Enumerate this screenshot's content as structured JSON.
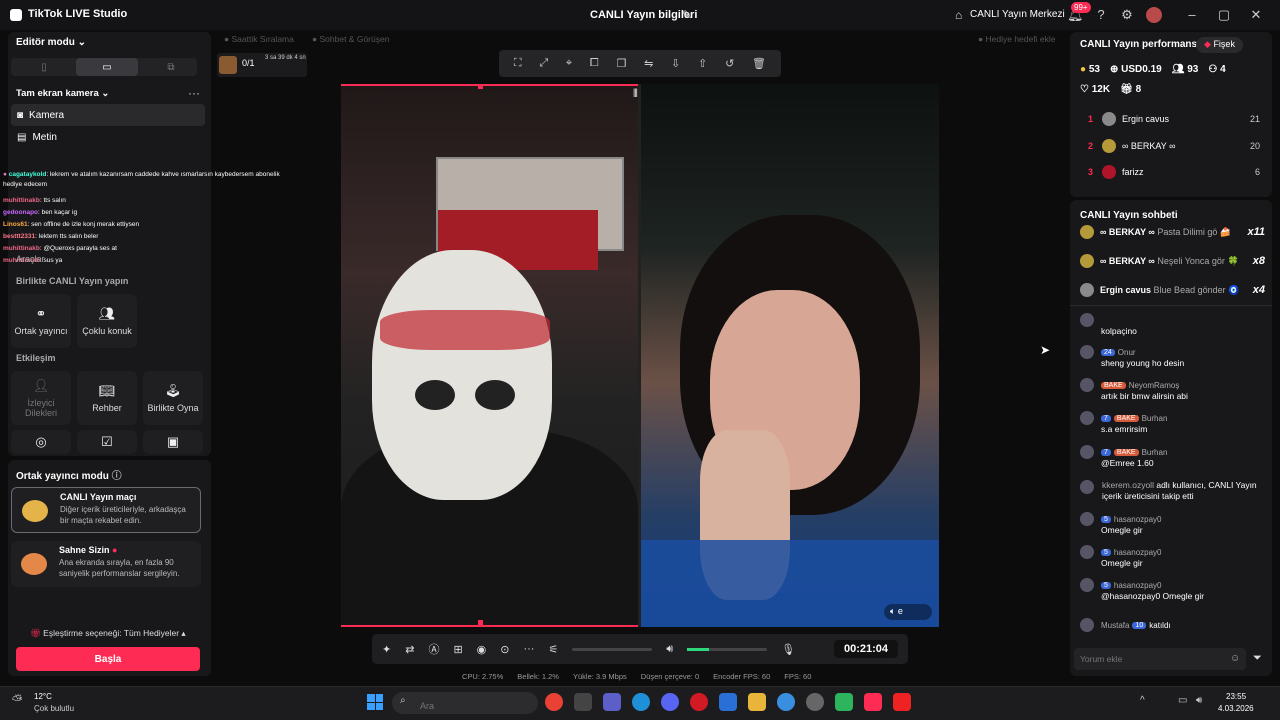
{
  "app": {
    "title": "TikTok LIVE Studio",
    "center_title": "CANLI Yayın bilgileri",
    "home_label": "CANLI Yayın Merkezi",
    "notif_count": "99+"
  },
  "editor": {
    "mode_label": "Editör modu",
    "camera_header": "Tam ekran kamera",
    "sources": [
      "Kamera",
      "Metin"
    ],
    "tools_label": "Araçlar",
    "together_label": "Birlikte CANLI Yayın yapın",
    "together_tiles": [
      "Ortak yayıncı",
      "Çoklu konuk"
    ],
    "interaction_label": "Etkileşim",
    "interaction_tiles": [
      "İzleyici Dilekleri",
      "Rehber",
      "Birlikte Oyna"
    ]
  },
  "cohost": {
    "mode_label": "Ortak yayıncı modu",
    "cards": [
      {
        "title": "CANLI Yayın maçı",
        "desc": "Diğer içerik üreticileriyle, arkadaşça bir maçta rekabet edin."
      },
      {
        "title": "Sahne Sizin",
        "desc": "Ana ekranda sırayla, en fazla 90 saniyelik performanslar sergileyin."
      }
    ],
    "match_option": "Eşleştirme seçeneği: Tüm Hediyeler",
    "start_button": "Başla"
  },
  "overlay_chat": [
    {
      "user": "cagataykold",
      "text": ": lekrem ve atalım kazanırsam caddede kahve ısmarlarsın kaybedersem abonelik hediye edecem"
    },
    {
      "user": "muhittinakb",
      "text": ": tts salın"
    },
    {
      "user": "gedoonapo",
      "text": ": ben kaçar ig"
    },
    {
      "user": "Linos61",
      "text": ": sen offline de izle konj merak ettiysen"
    },
    {
      "user": "besttt2331",
      "text": ": lektem tts salın beler"
    },
    {
      "user": "muhittinakb",
      "text": ": @Queroxs parayla ses at"
    },
    {
      "user": "muhittinakb",
      "text": ": sus ya"
    }
  ],
  "scene_bar": {
    "tab1": "Saattik Sıralama",
    "tab2": "Sohbet & Görüşen",
    "gift_label": "Hediye hedefi ekle",
    "goal_count": "0/1",
    "goal_time": "3 sa 39 dk 4 sn"
  },
  "controls": {
    "timer": "00:21:04"
  },
  "stats": {
    "cpu": "CPU: 2.75%",
    "mem": "Bellek: 1.2%",
    "upload": "Yükle: 3.9 Mbps",
    "dropped": "Düşen çerçeve: 0",
    "encoder": "Encoder FPS: 60",
    "fps": "FPS: 60"
  },
  "performance": {
    "title": "CANLI Yayın performansı",
    "badge": "Fişek",
    "coins": "53",
    "usd": "USD0.19",
    "viewers": "93",
    "people": "4",
    "likes": "12K",
    "gifts": "8",
    "leaderboard": [
      {
        "rank": "1",
        "name": "Ergin cavus",
        "score": "21",
        "color": "#8a8a8a"
      },
      {
        "rank": "2",
        "name": "∞ BERKAY ∞",
        "score": "20",
        "color": "#b59a3a"
      },
      {
        "rank": "3",
        "name": "farizz",
        "score": "6",
        "color": "#b0142a"
      }
    ]
  },
  "chat": {
    "title": "CANLI Yayın sohbeti",
    "gifts": [
      {
        "name": "∞ BERKAY ∞",
        "action": "Pasta Dilimi gö",
        "count": "x11",
        "icon": "🍰"
      },
      {
        "name": "∞ BERKAY ∞",
        "action": "Neşeli Yonca gör",
        "count": "x8",
        "icon": "🍀"
      },
      {
        "name": "Ergin cavus",
        "action": "Blue Bead gönder",
        "count": "x4",
        "icon": "🧿"
      }
    ],
    "messages": [
      {
        "user": "",
        "lvl": "",
        "bake": false,
        "text": "kolpaçino"
      },
      {
        "user": "Onur",
        "lvl": "24",
        "bake": false,
        "text": "sheng young ho desin"
      },
      {
        "user": "NeyomRamoş",
        "lvl": "",
        "bake": true,
        "text": "artık bir bmw alirsin abi"
      },
      {
        "user": "Burhan",
        "lvl": "7",
        "bake": true,
        "text": "s.a emrirsim"
      },
      {
        "user": "Burhan",
        "lvl": "7",
        "bake": true,
        "text": "@Emree 1.60"
      },
      {
        "user": "kkerem.ozyoll",
        "lvl": "",
        "bake": false,
        "text": "adlı kullanıcı, CANLI Yayın içerik üreticisini takip etti"
      },
      {
        "user": "hasanozpay0",
        "lvl": "5",
        "bake": false,
        "text": "Omegle gir"
      },
      {
        "user": "hasanozpay0",
        "lvl": "5",
        "bake": false,
        "text": "Omegle gir"
      },
      {
        "user": "hasanozpay0",
        "lvl": "5",
        "bake": false,
        "text": "@hasanozpay0 Omegle gir"
      }
    ],
    "joined_user": "Mustafa",
    "joined_lvl": "10",
    "joined_text": "katıldı",
    "input_placeholder": "Yorum ekle"
  },
  "taskbar": {
    "temp": "12°C",
    "weather": "Çok bulutlu",
    "search_placeholder": "Ara",
    "time": "23:55",
    "date": "4.03.2026"
  }
}
